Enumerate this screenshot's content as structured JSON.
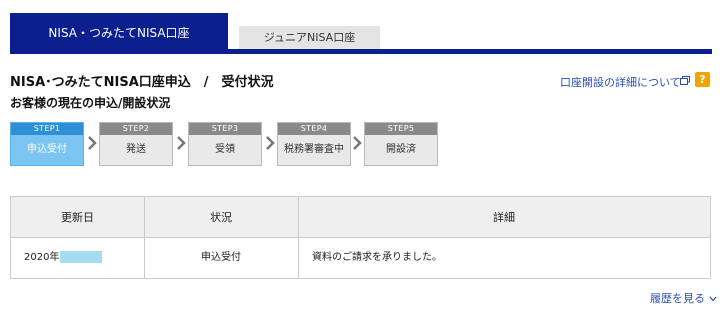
{
  "tabs": {
    "active": "NISA・つみたてNISA口座",
    "inactive": "ジュニアNISA口座"
  },
  "header": {
    "title": "NISA･つみたてNISA口座申込　/　受付状況",
    "subtitle": "お客様の現在の申込/開設状況",
    "help_link": "口座開設の詳細について",
    "help_badge": "?"
  },
  "steps": [
    {
      "num": "STEP1",
      "label": "申込受付",
      "active": true
    },
    {
      "num": "STEP2",
      "label": "発送",
      "active": false
    },
    {
      "num": "STEP3",
      "label": "受領",
      "active": false
    },
    {
      "num": "STEP4",
      "label": "税務署審査中",
      "active": false
    },
    {
      "num": "STEP5",
      "label": "開設済",
      "active": false
    }
  ],
  "table": {
    "headers": [
      "更新日",
      "状況",
      "詳細"
    ],
    "row": {
      "date": "2020年",
      "status": "申込受付",
      "detail": "資料のご請求を承りました。"
    }
  },
  "history_link": "履歴を見る",
  "colors": {
    "brand_navy": "#0b1f8f",
    "step_active": "#7cc4f2",
    "link": "#2a4fb3",
    "help_badge": "#f0a500"
  }
}
